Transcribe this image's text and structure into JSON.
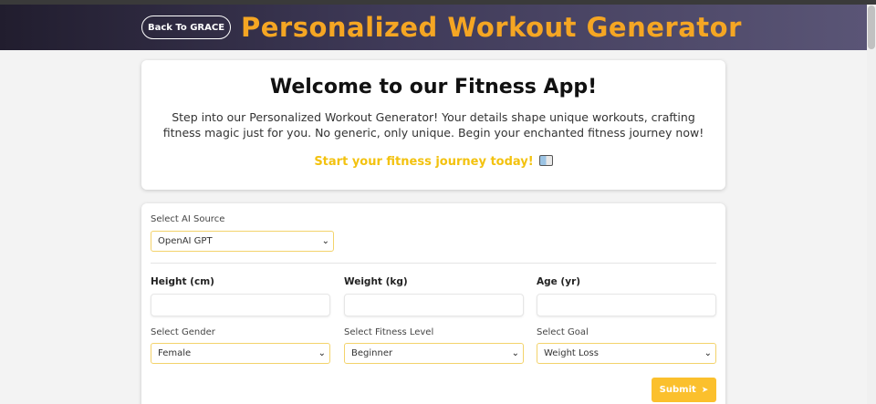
{
  "header": {
    "back_label": "Back To GRACE",
    "title": "Personalized Workout Generator"
  },
  "welcome": {
    "title": "Welcome to our Fitness App!",
    "text": "Step into our Personalized Workout Generator! Your details shape unique workouts, crafting fitness magic just for you. No generic, only unique. Begin your enchanted fitness journey now!",
    "cta": "Start your fitness journey today!",
    "cta_icon": "picture-frame-icon"
  },
  "form": {
    "ai_source": {
      "label": "Select AI Source",
      "value": "OpenAI GPT"
    },
    "height": {
      "label": "Height (cm)",
      "value": ""
    },
    "weight": {
      "label": "Weight (kg)",
      "value": ""
    },
    "age": {
      "label": "Age (yr)",
      "value": ""
    },
    "gender": {
      "label": "Select Gender",
      "value": "Female"
    },
    "fitness_level": {
      "label": "Select Fitness Level",
      "value": "Beginner"
    },
    "goal": {
      "label": "Select Goal",
      "value": "Weight Loss"
    },
    "submit_label": "Submit",
    "submit_icon": "arrow-right-icon"
  },
  "colors": {
    "title": "#f5a623",
    "accent": "#fbc02d",
    "cta": "#f3c20f",
    "header_start": "#211d2e",
    "header_end": "#5a5576"
  }
}
